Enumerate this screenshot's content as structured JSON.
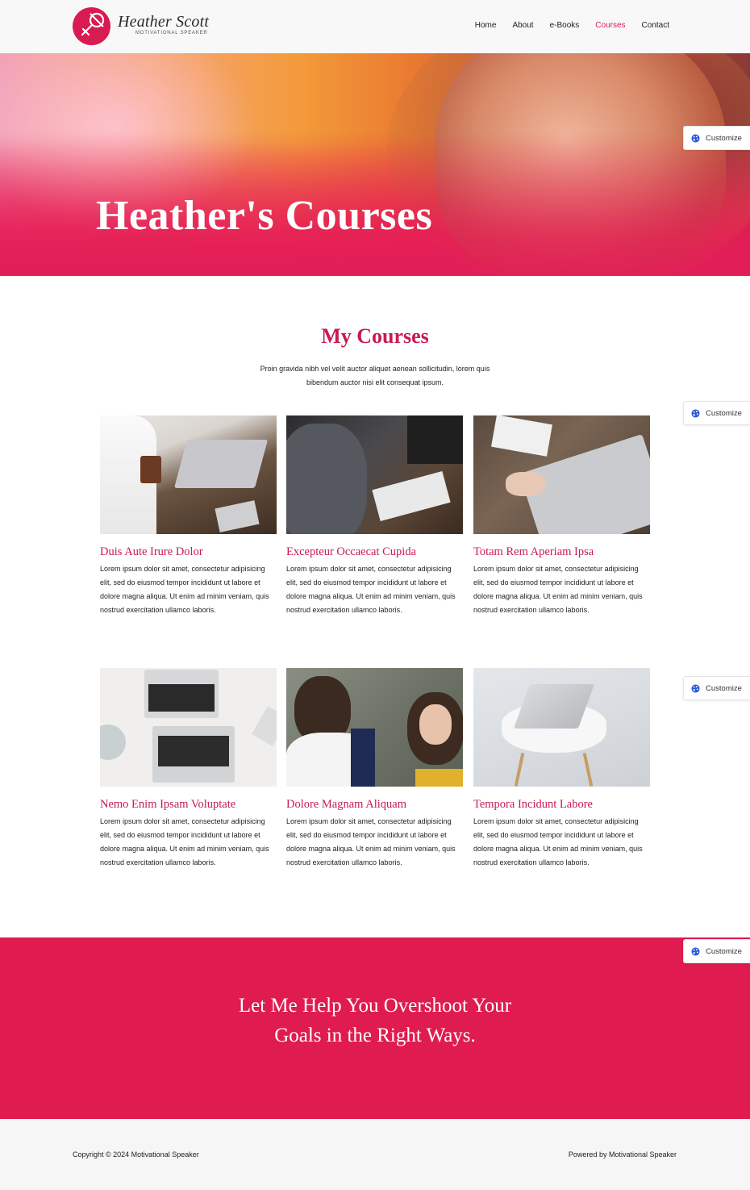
{
  "header": {
    "brand_name": "Heather Scott",
    "brand_tagline": "MOTIVATIONAL SPEAKER",
    "nav": [
      {
        "label": "Home",
        "active": false
      },
      {
        "label": "About",
        "active": false
      },
      {
        "label": "e-Books",
        "active": false
      },
      {
        "label": "Courses",
        "active": true
      },
      {
        "label": "Contact",
        "active": false
      }
    ]
  },
  "hero": {
    "title": "Heather's Courses"
  },
  "customize_label": "Customize",
  "courses": {
    "title": "My Courses",
    "description": "Proin gravida nibh vel velit auctor aliquet aenean sollicitudin, lorem quis bibendum auctor nisi elit consequat ipsum.",
    "items": [
      {
        "title": "Duis Aute Irure Dolor",
        "text": "Lorem ipsum dolor sit amet, consectetur adipisicing elit, sed do eiusmod tempor incididunt ut labore et dolore magna aliqua. Ut enim ad minim veniam, quis nostrud exercitation ullamco laboris."
      },
      {
        "title": "Excepteur Occaecat Cupida",
        "text": "Lorem ipsum dolor sit amet, consectetur adipisicing elit, sed do eiusmod tempor incididunt ut labore et dolore magna aliqua. Ut enim ad minim veniam, quis nostrud exercitation ullamco laboris."
      },
      {
        "title": "Totam Rem Aperiam Ipsa",
        "text": "Lorem ipsum dolor sit amet, consectetur adipisicing elit, sed do eiusmod tempor incididunt ut labore et dolore magna aliqua. Ut enim ad minim veniam, quis nostrud exercitation ullamco laboris."
      },
      {
        "title": "Nemo Enim Ipsam Voluptate",
        "text": "Lorem ipsum dolor sit amet, consectetur adipisicing elit, sed do eiusmod tempor incididunt ut labore et dolore magna aliqua. Ut enim ad minim veniam, quis nostrud exercitation ullamco laboris."
      },
      {
        "title": "Dolore Magnam Aliquam",
        "text": "Lorem ipsum dolor sit amet, consectetur adipisicing elit, sed do eiusmod tempor incididunt ut labore et dolore magna aliqua. Ut enim ad minim veniam, quis nostrud exercitation ullamco laboris."
      },
      {
        "title": "Tempora Incidunt Labore",
        "text": "Lorem ipsum dolor sit amet, consectetur adipisicing elit, sed do eiusmod tempor incididunt ut labore et dolore magna aliqua. Ut enim ad minim veniam, quis nostrud exercitation ullamco laboris."
      }
    ]
  },
  "cta": {
    "line1": "Let Me Help You Overshoot Your",
    "line2": "Goals in the Right Ways."
  },
  "footer": {
    "copyright": "Copyright © 2024 Motivational Speaker",
    "powered": "Powered by Motivational Speaker"
  },
  "colors": {
    "accent": "#d81b51",
    "cta_bg": "#e01b4f"
  }
}
